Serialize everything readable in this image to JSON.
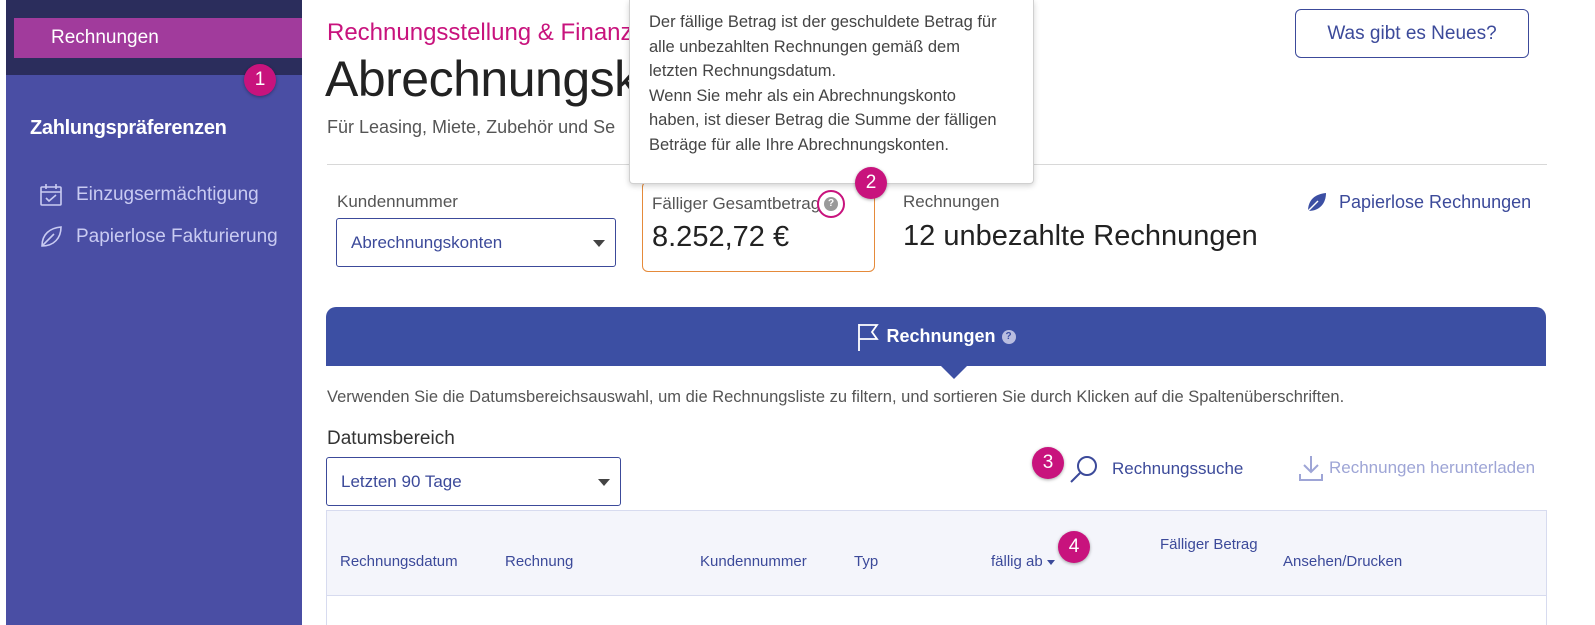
{
  "sidebar": {
    "active_item": "Rechnungen",
    "section_title": "Zahlungspräferenzen",
    "links": [
      {
        "label": "Einzugsermächtigung",
        "icon": "calendar-check-icon"
      },
      {
        "label": "Papierlose Fakturierung",
        "icon": "leaf-icon"
      }
    ]
  },
  "markers": [
    "1",
    "2",
    "3",
    "4"
  ],
  "header": {
    "eyebrow": "Rechnungsstellung & Finanz",
    "title": "Abrechnungsk",
    "subtitle": "Für Leasing, Miete, Zubehör und Se",
    "whats_new": "Was gibt es Neues?"
  },
  "tooltip": {
    "line1": "Der fällige Betrag ist der geschuldete Betrag für",
    "line2": "alle unbezahlten Rechnungen gemäß dem",
    "line3": "letzten Rechnungsdatum.",
    "line4": "Wenn Sie mehr als ein Abrechnungskonto",
    "line5": "haben, ist dieser Betrag die Summe der fälligen",
    "line6": "Beträge für alle Ihre Abrechnungskonten."
  },
  "summary": {
    "customer_label": "Kundennummer",
    "customer_select": "Abrechnungskonten",
    "amount_label": "Fälliger Gesamtbetrag",
    "amount_value": "8.252,72 €",
    "invoices_label": "Rechnungen",
    "invoices_value": "12 unbezahlte Rechnungen",
    "paperless_link": "Papierlose Rechnungen"
  },
  "tab": {
    "label": "Rechnungen",
    "help": "?"
  },
  "instructions": "Verwenden Sie die Datumsbereichsauswahl, um die Rechnungsliste zu filtern, und sortieren Sie durch Klicken auf die Spaltenüberschriften.",
  "filter": {
    "label": "Datumsbereich",
    "value": "Letzten 90 Tage"
  },
  "actions": {
    "search": "Rechnungssuche",
    "download": "Rechnungen herunterladen"
  },
  "table": {
    "columns": [
      "Rechnungsdatum",
      "Rechnung",
      "Kundennummer",
      "Typ",
      "fällig ab",
      "Fälliger Betrag",
      "Ansehen/Drucken"
    ]
  },
  "colors": {
    "brand_magenta": "#c8137d",
    "brand_blue": "#3c4fa3",
    "sidebar": "#4a4ea4",
    "accent_orange": "#e58a3a"
  }
}
